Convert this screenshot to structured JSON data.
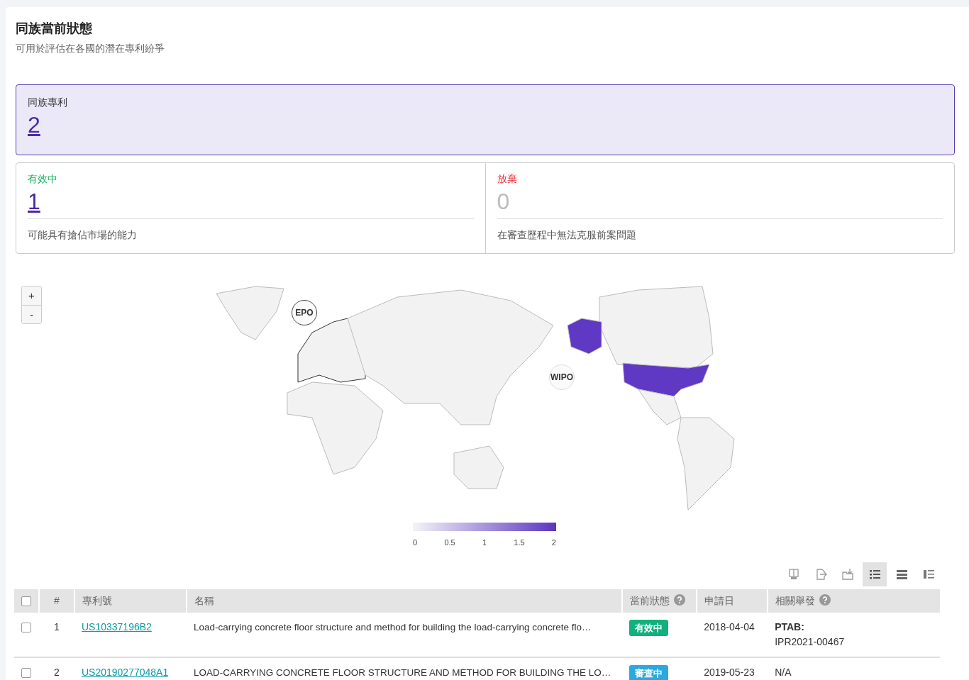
{
  "header": {
    "title": "同族當前狀態",
    "subtitle": "可用於評估在各國的潛在專利紛爭"
  },
  "family": {
    "label": "同族專利",
    "count": "2",
    "selected": true
  },
  "statuses": [
    {
      "label": "有效中",
      "count": "1",
      "description": "可能具有搶佔市場的能力",
      "kind": "active",
      "disabled": false,
      "selected": false
    },
    {
      "label": "放棄",
      "count": "0",
      "description": "在審查歷程中無法克服前案問題",
      "kind": "abandoned",
      "disabled": true,
      "selected": false
    }
  ],
  "map": {
    "zoom_buttons": [
      "+",
      "-"
    ],
    "markers": [
      {
        "label": "EPO",
        "kind": "epo"
      },
      {
        "label": "WIPO",
        "kind": "wipo"
      }
    ],
    "legend_ticks": [
      "0",
      "0.5",
      "1",
      "1.5",
      "2"
    ]
  },
  "view_options": [
    {
      "kind": "monitor",
      "selected": false
    },
    {
      "kind": "export",
      "selected": false
    },
    {
      "kind": "folder",
      "selected": false
    },
    {
      "kind": "list",
      "selected": true
    },
    {
      "kind": "rows",
      "selected": false
    },
    {
      "kind": "detail",
      "selected": false
    }
  ],
  "table": {
    "columns": [
      {
        "kind": "checkbox"
      },
      {
        "label": "#",
        "kind": "index"
      },
      {
        "label": "專利號",
        "kind": "text"
      },
      {
        "label": "名稱",
        "kind": "text"
      },
      {
        "label": "當前狀態",
        "kind": "help"
      },
      {
        "label": "申請日",
        "kind": "text"
      },
      {
        "label": "相關舉發",
        "kind": "help"
      }
    ],
    "header_checked": false,
    "rows": [
      {
        "checked": false,
        "index": "1",
        "number": "US10337196B2",
        "name": "Load-carrying concrete floor structure and method for building the load-carrying concrete flo…",
        "status": {
          "label": "有效中",
          "kind": "active"
        },
        "date": "2018-04-04",
        "related": [
          "**PTAB:**",
          "IPR2021-00467"
        ]
      },
      {
        "checked": false,
        "index": "2",
        "number": "US20190277048A1",
        "name": "LOAD-CARRYING CONCRETE FLOOR STRUCTURE AND METHOD FOR BUILDING THE LO…",
        "status": {
          "label": "審查中",
          "kind": "pending"
        },
        "date": "2019-05-23",
        "related": [
          "N/A"
        ]
      }
    ]
  }
}
